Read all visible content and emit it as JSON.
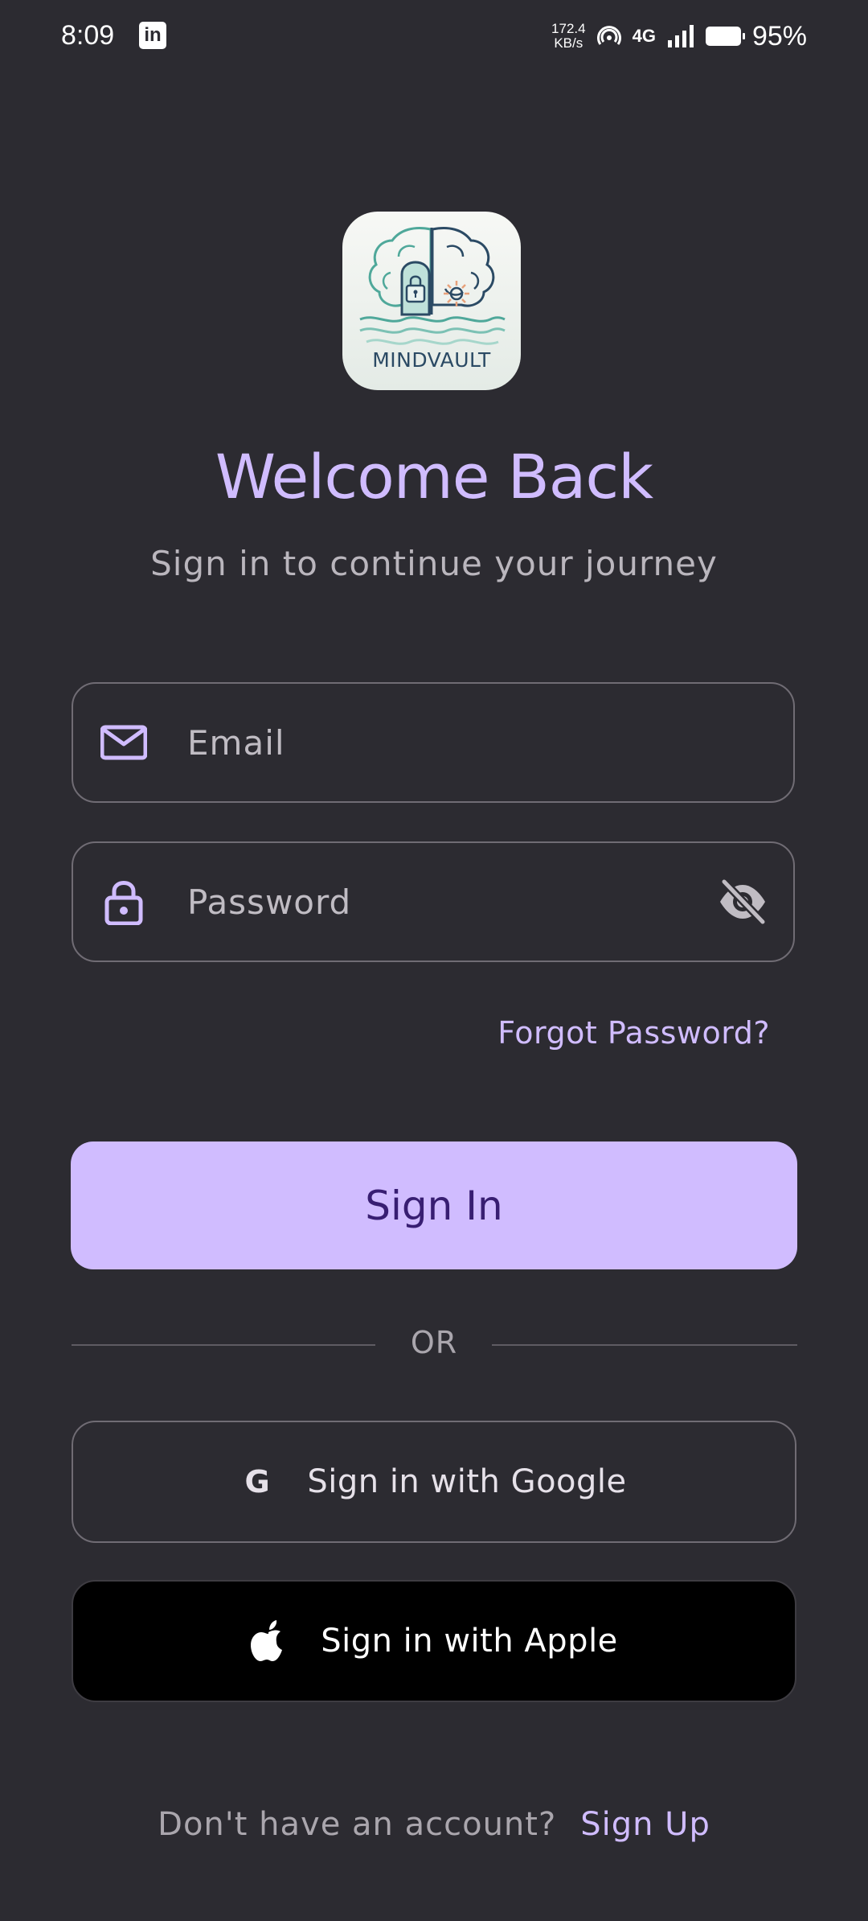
{
  "status_bar": {
    "time": "8:09",
    "app_icon_label": "in",
    "net_speed_value": "172.4",
    "net_speed_unit": "KB/s",
    "network": "4G",
    "battery": "95%"
  },
  "logo": {
    "icon": "mindvault-brain-lock-logo",
    "text": "MINDVAULT"
  },
  "header": {
    "title": "Welcome Back",
    "subtitle": "Sign in to continue your journey"
  },
  "form": {
    "email_placeholder": "Email",
    "email_icon": "mail-icon",
    "password_placeholder": "Password",
    "password_icon": "lock-icon",
    "visibility_icon": "eye-off-icon",
    "forgot_label": "Forgot Password?",
    "signin_label": "Sign In"
  },
  "divider": {
    "label": "OR"
  },
  "social": {
    "google_icon_glyph": "G",
    "google_label": "Sign in with Google",
    "apple_label": "Sign in with Apple"
  },
  "footer": {
    "prompt": "Don't have an account?",
    "signup_label": "Sign Up"
  },
  "colors": {
    "background": "#2c2b31",
    "accent": "#d0bcff",
    "accent_on": "#381e72",
    "outline": "#706c74"
  }
}
